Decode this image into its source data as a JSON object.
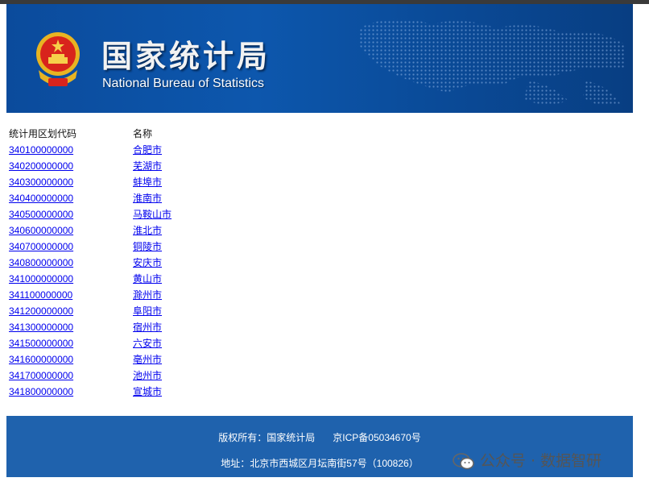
{
  "header": {
    "title_cn": "国家统计局",
    "title_en": "National Bureau of Statistics"
  },
  "table": {
    "headers": [
      "统计用区划代码",
      "名称"
    ],
    "rows": [
      {
        "code": "340100000000",
        "name": "合肥市"
      },
      {
        "code": "340200000000",
        "name": "芜湖市"
      },
      {
        "code": "340300000000",
        "name": "蚌埠市"
      },
      {
        "code": "340400000000",
        "name": "淮南市"
      },
      {
        "code": "340500000000",
        "name": "马鞍山市"
      },
      {
        "code": "340600000000",
        "name": "淮北市"
      },
      {
        "code": "340700000000",
        "name": "铜陵市"
      },
      {
        "code": "340800000000",
        "name": "安庆市"
      },
      {
        "code": "341000000000",
        "name": "黄山市"
      },
      {
        "code": "341100000000",
        "name": "滁州市"
      },
      {
        "code": "341200000000",
        "name": "阜阳市"
      },
      {
        "code": "341300000000",
        "name": "宿州市"
      },
      {
        "code": "341500000000",
        "name": "六安市"
      },
      {
        "code": "341600000000",
        "name": "亳州市"
      },
      {
        "code": "341700000000",
        "name": "池州市"
      },
      {
        "code": "341800000000",
        "name": "宣城市"
      }
    ]
  },
  "footer": {
    "copyright": "版权所有：国家统计局",
    "icp": "京ICP备05034670号",
    "address": "地址：北京市西城区月坛南街57号（100826）"
  },
  "watermark": {
    "text": "公众号 · 数据智研",
    "icon": "wechat-icon"
  },
  "colors": {
    "banner_blue": "#0d57ad",
    "footer_blue": "#1f62ad",
    "link": "#0000ee"
  }
}
